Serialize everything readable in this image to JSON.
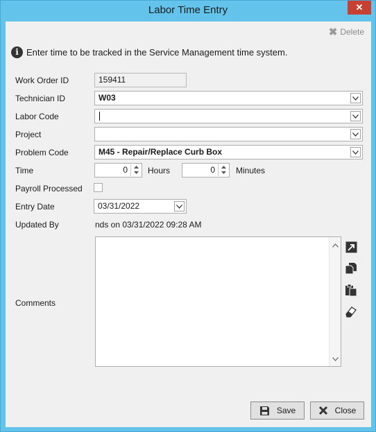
{
  "window": {
    "title": "Labor Time Entry",
    "close_glyph": "✕"
  },
  "toolbar": {
    "delete_label": "Delete",
    "delete_icon": "x-icon"
  },
  "info": {
    "text": "Enter time to be tracked in the Service Management time system."
  },
  "form": {
    "work_order": {
      "label": "Work Order ID",
      "value": "159411"
    },
    "technician": {
      "label": "Technician ID",
      "value": "W03"
    },
    "labor_code": {
      "label": "Labor Code",
      "value": ""
    },
    "project": {
      "label": "Project",
      "value": ""
    },
    "problem_code": {
      "label": "Problem Code",
      "value": "M45 - Repair/Replace Curb Box"
    },
    "time": {
      "label": "Time",
      "hours_value": "0",
      "hours_label": "Hours",
      "minutes_value": "0",
      "minutes_label": "Minutes"
    },
    "payroll": {
      "label": "Payroll Processed",
      "checked": false
    },
    "entry_date": {
      "label": "Entry Date",
      "value": "03/31/2022"
    },
    "updated_by": {
      "label": "Updated By",
      "value": "nds on 03/31/2022 09:28 AM"
    },
    "comments": {
      "label": "Comments",
      "value": ""
    }
  },
  "comment_tools": [
    "expand-icon",
    "copy-icon",
    "paste-icon",
    "eraser-icon"
  ],
  "buttons": {
    "save_label": "Save",
    "close_label": "Close"
  },
  "colors": {
    "title_bar": "#63c3ea",
    "close_button": "#c84031",
    "client_bg": "#f0f0f0"
  }
}
